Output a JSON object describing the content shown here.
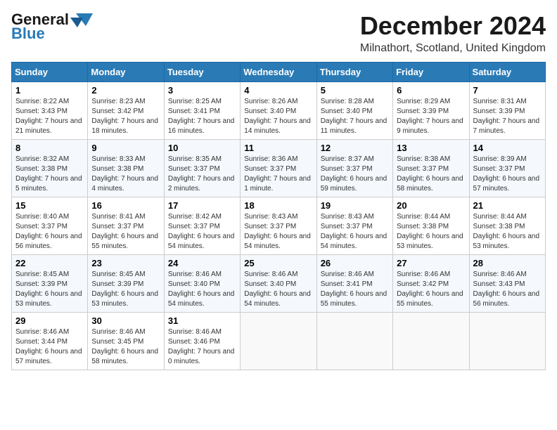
{
  "logo": {
    "line1": "General",
    "line2": "Blue"
  },
  "title": {
    "month_year": "December 2024",
    "location": "Milnathort, Scotland, United Kingdom"
  },
  "headers": [
    "Sunday",
    "Monday",
    "Tuesday",
    "Wednesday",
    "Thursday",
    "Friday",
    "Saturday"
  ],
  "weeks": [
    [
      {
        "day": "1",
        "sunrise": "Sunrise: 8:22 AM",
        "sunset": "Sunset: 3:43 PM",
        "daylight": "Daylight: 7 hours and 21 minutes."
      },
      {
        "day": "2",
        "sunrise": "Sunrise: 8:23 AM",
        "sunset": "Sunset: 3:42 PM",
        "daylight": "Daylight: 7 hours and 18 minutes."
      },
      {
        "day": "3",
        "sunrise": "Sunrise: 8:25 AM",
        "sunset": "Sunset: 3:41 PM",
        "daylight": "Daylight: 7 hours and 16 minutes."
      },
      {
        "day": "4",
        "sunrise": "Sunrise: 8:26 AM",
        "sunset": "Sunset: 3:40 PM",
        "daylight": "Daylight: 7 hours and 14 minutes."
      },
      {
        "day": "5",
        "sunrise": "Sunrise: 8:28 AM",
        "sunset": "Sunset: 3:40 PM",
        "daylight": "Daylight: 7 hours and 11 minutes."
      },
      {
        "day": "6",
        "sunrise": "Sunrise: 8:29 AM",
        "sunset": "Sunset: 3:39 PM",
        "daylight": "Daylight: 7 hours and 9 minutes."
      },
      {
        "day": "7",
        "sunrise": "Sunrise: 8:31 AM",
        "sunset": "Sunset: 3:39 PM",
        "daylight": "Daylight: 7 hours and 7 minutes."
      }
    ],
    [
      {
        "day": "8",
        "sunrise": "Sunrise: 8:32 AM",
        "sunset": "Sunset: 3:38 PM",
        "daylight": "Daylight: 7 hours and 5 minutes."
      },
      {
        "day": "9",
        "sunrise": "Sunrise: 8:33 AM",
        "sunset": "Sunset: 3:38 PM",
        "daylight": "Daylight: 7 hours and 4 minutes."
      },
      {
        "day": "10",
        "sunrise": "Sunrise: 8:35 AM",
        "sunset": "Sunset: 3:37 PM",
        "daylight": "Daylight: 7 hours and 2 minutes."
      },
      {
        "day": "11",
        "sunrise": "Sunrise: 8:36 AM",
        "sunset": "Sunset: 3:37 PM",
        "daylight": "Daylight: 7 hours and 1 minute."
      },
      {
        "day": "12",
        "sunrise": "Sunrise: 8:37 AM",
        "sunset": "Sunset: 3:37 PM",
        "daylight": "Daylight: 6 hours and 59 minutes."
      },
      {
        "day": "13",
        "sunrise": "Sunrise: 8:38 AM",
        "sunset": "Sunset: 3:37 PM",
        "daylight": "Daylight: 6 hours and 58 minutes."
      },
      {
        "day": "14",
        "sunrise": "Sunrise: 8:39 AM",
        "sunset": "Sunset: 3:37 PM",
        "daylight": "Daylight: 6 hours and 57 minutes."
      }
    ],
    [
      {
        "day": "15",
        "sunrise": "Sunrise: 8:40 AM",
        "sunset": "Sunset: 3:37 PM",
        "daylight": "Daylight: 6 hours and 56 minutes."
      },
      {
        "day": "16",
        "sunrise": "Sunrise: 8:41 AM",
        "sunset": "Sunset: 3:37 PM",
        "daylight": "Daylight: 6 hours and 55 minutes."
      },
      {
        "day": "17",
        "sunrise": "Sunrise: 8:42 AM",
        "sunset": "Sunset: 3:37 PM",
        "daylight": "Daylight: 6 hours and 54 minutes."
      },
      {
        "day": "18",
        "sunrise": "Sunrise: 8:43 AM",
        "sunset": "Sunset: 3:37 PM",
        "daylight": "Daylight: 6 hours and 54 minutes."
      },
      {
        "day": "19",
        "sunrise": "Sunrise: 8:43 AM",
        "sunset": "Sunset: 3:37 PM",
        "daylight": "Daylight: 6 hours and 54 minutes."
      },
      {
        "day": "20",
        "sunrise": "Sunrise: 8:44 AM",
        "sunset": "Sunset: 3:38 PM",
        "daylight": "Daylight: 6 hours and 53 minutes."
      },
      {
        "day": "21",
        "sunrise": "Sunrise: 8:44 AM",
        "sunset": "Sunset: 3:38 PM",
        "daylight": "Daylight: 6 hours and 53 minutes."
      }
    ],
    [
      {
        "day": "22",
        "sunrise": "Sunrise: 8:45 AM",
        "sunset": "Sunset: 3:39 PM",
        "daylight": "Daylight: 6 hours and 53 minutes."
      },
      {
        "day": "23",
        "sunrise": "Sunrise: 8:45 AM",
        "sunset": "Sunset: 3:39 PM",
        "daylight": "Daylight: 6 hours and 53 minutes."
      },
      {
        "day": "24",
        "sunrise": "Sunrise: 8:46 AM",
        "sunset": "Sunset: 3:40 PM",
        "daylight": "Daylight: 6 hours and 54 minutes."
      },
      {
        "day": "25",
        "sunrise": "Sunrise: 8:46 AM",
        "sunset": "Sunset: 3:40 PM",
        "daylight": "Daylight: 6 hours and 54 minutes."
      },
      {
        "day": "26",
        "sunrise": "Sunrise: 8:46 AM",
        "sunset": "Sunset: 3:41 PM",
        "daylight": "Daylight: 6 hours and 55 minutes."
      },
      {
        "day": "27",
        "sunrise": "Sunrise: 8:46 AM",
        "sunset": "Sunset: 3:42 PM",
        "daylight": "Daylight: 6 hours and 55 minutes."
      },
      {
        "day": "28",
        "sunrise": "Sunrise: 8:46 AM",
        "sunset": "Sunset: 3:43 PM",
        "daylight": "Daylight: 6 hours and 56 minutes."
      }
    ],
    [
      {
        "day": "29",
        "sunrise": "Sunrise: 8:46 AM",
        "sunset": "Sunset: 3:44 PM",
        "daylight": "Daylight: 6 hours and 57 minutes."
      },
      {
        "day": "30",
        "sunrise": "Sunrise: 8:46 AM",
        "sunset": "Sunset: 3:45 PM",
        "daylight": "Daylight: 6 hours and 58 minutes."
      },
      {
        "day": "31",
        "sunrise": "Sunrise: 8:46 AM",
        "sunset": "Sunset: 3:46 PM",
        "daylight": "Daylight: 7 hours and 0 minutes."
      },
      {
        "day": "",
        "sunrise": "",
        "sunset": "",
        "daylight": ""
      },
      {
        "day": "",
        "sunrise": "",
        "sunset": "",
        "daylight": ""
      },
      {
        "day": "",
        "sunrise": "",
        "sunset": "",
        "daylight": ""
      },
      {
        "day": "",
        "sunrise": "",
        "sunset": "",
        "daylight": ""
      }
    ]
  ]
}
